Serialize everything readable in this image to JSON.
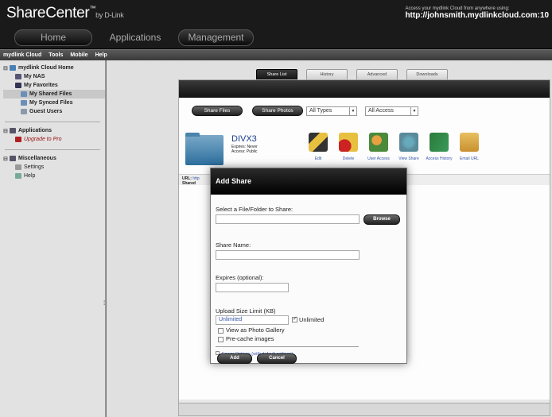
{
  "header": {
    "logo": "ShareCenter",
    "logo_tm": "™",
    "logo_by": "by D-Link",
    "cloud_note": "Access your mydlink Cloud from anywhere using:",
    "cloud_url": "http://johnsmith.mydlinkcloud.com:10",
    "nav": {
      "home": "Home",
      "apps": "Applications",
      "mgmt": "Management"
    }
  },
  "menubar": {
    "items": [
      "mydlink Cloud",
      "Tools",
      "Mobile",
      "Help"
    ]
  },
  "sidebar": {
    "root": "mydlink Cloud Home",
    "items": [
      "My NAS",
      "My Favorites",
      "My Shared Files",
      "My Synced Files",
      "Guest Users"
    ],
    "applications": "Applications",
    "upgrade": "Upgrade to Pro",
    "misc": "Miscellaneous",
    "settings": "Settings",
    "help": "Help"
  },
  "tabs": [
    "Share List",
    "History",
    "Advanced",
    "Downloads"
  ],
  "filters": {
    "share_files": "Share Files",
    "share_photos": "Share Photos",
    "type": "All Types",
    "access": "All Access"
  },
  "share": {
    "name": "DIVX3",
    "expires": "Expires: Never",
    "access": "Access: Public",
    "actions": [
      "Edit",
      "Delete",
      "User Access",
      "View Share",
      "Access History",
      "Email URL"
    ],
    "url_label": "URL:",
    "url_value": "http",
    "shared_label": "Shared"
  },
  "dialog": {
    "title": "Add Share",
    "select_label": "Select a File/Folder to Share:",
    "browse": "Browse",
    "share_name_label": "Share Name:",
    "expires_label": "Expires (optional):",
    "upload_label": "Upload Size Limit (KB)",
    "upload_value": "Unlimited",
    "unlimited": "Unlimited",
    "photo_gallery": "View as Photo Gallery",
    "precache": "Pre-cache images",
    "fewer_options": "Fewer Options (with default settings)",
    "add": "Add",
    "cancel": "Cancel"
  },
  "colors": {
    "accent_link": "#3355aa",
    "pro_red": "#9a1010"
  }
}
